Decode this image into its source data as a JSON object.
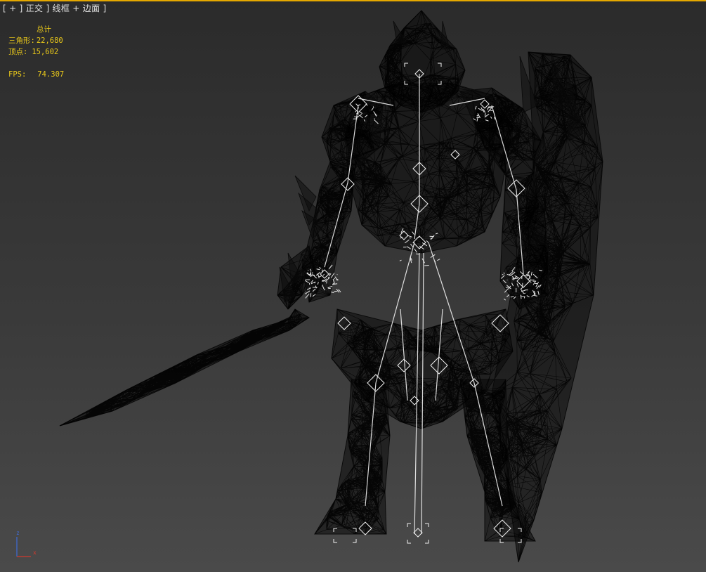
{
  "viewport": {
    "label_parts": [
      "[",
      "+",
      "]",
      "正交",
      "]",
      "线框",
      "+",
      "边面",
      "]"
    ],
    "active_border_color": "#e5a800"
  },
  "stats": {
    "heading": "总计",
    "triangles_label": "三角形:",
    "triangles_value": "22,680",
    "vertices_label": "顶点:",
    "vertices_value": "15,602",
    "fps_label": "FPS:",
    "fps_value": "74.307",
    "color": "#e9c81a"
  },
  "gizmo": {
    "z_label": "z",
    "x_label": "x",
    "z_color": "#3f6bd6",
    "x_color": "#d03a2e"
  },
  "model": {
    "mesh_color": "#0a0a0a",
    "bone_color": "#f2f2f2"
  }
}
